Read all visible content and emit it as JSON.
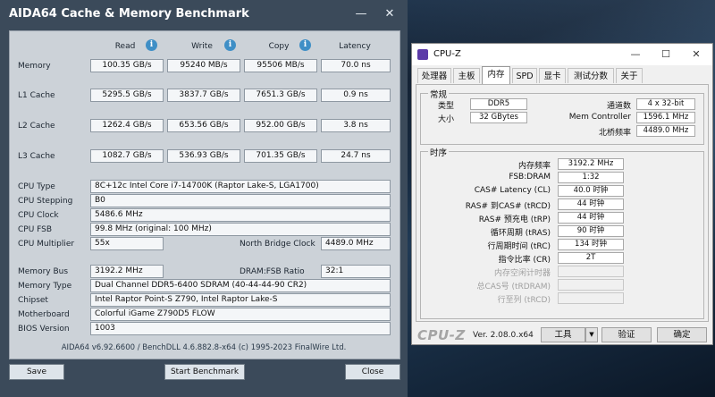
{
  "aida": {
    "title": "AIDA64 Cache & Memory Benchmark",
    "window_controls": {
      "minimize": "—",
      "close": "✕"
    },
    "columns": [
      "Read",
      "Write",
      "Copy",
      "Latency"
    ],
    "bench_rows": [
      {
        "label": "Memory",
        "read": "100.35 GB/s",
        "write": "95240 MB/s",
        "copy": "95506 MB/s",
        "latency": "70.0 ns"
      },
      {
        "label": "L1 Cache",
        "read": "5295.5 GB/s",
        "write": "3837.7 GB/s",
        "copy": "7651.3 GB/s",
        "latency": "0.9 ns"
      },
      {
        "label": "L2 Cache",
        "read": "1262.4 GB/s",
        "write": "653.56 GB/s",
        "copy": "952.00 GB/s",
        "latency": "3.8 ns"
      },
      {
        "label": "L3 Cache",
        "read": "1082.7 GB/s",
        "write": "536.93 GB/s",
        "copy": "701.35 GB/s",
        "latency": "24.7 ns"
      }
    ],
    "cpu": {
      "type_label": "CPU Type",
      "type": "8C+12c Intel Core i7-14700K  (Raptor Lake-S, LGA1700)",
      "stepping_label": "CPU Stepping",
      "stepping": "B0",
      "clock_label": "CPU Clock",
      "clock": "5486.6 MHz",
      "fsb_label": "CPU FSB",
      "fsb": "99.8 MHz  (original: 100 MHz)",
      "mult_label": "CPU Multiplier",
      "mult": "55x",
      "nb_label": "North Bridge Clock",
      "nb": "4489.0 MHz"
    },
    "mem": {
      "bus_label": "Memory Bus",
      "bus": "3192.2 MHz",
      "ratio_label": "DRAM:FSB Ratio",
      "ratio": "32:1",
      "type_label": "Memory Type",
      "type": "Dual Channel DDR5-6400 SDRAM  (40-44-44-90 CR2)",
      "chipset_label": "Chipset",
      "chipset": "Intel Raptor Point-S Z790, Intel Raptor Lake-S",
      "mb_label": "Motherboard",
      "mb": "Colorful iGame Z790D5 FLOW",
      "bios_label": "BIOS Version",
      "bios": "1003"
    },
    "footer": "AIDA64 v6.92.6600 / BenchDLL 4.6.882.8-x64  (c) 1995-2023 FinalWire Ltd.",
    "buttons": {
      "save": "Save",
      "start": "Start Benchmark",
      "close": "Close"
    }
  },
  "cpuz": {
    "title": "CPU-Z",
    "window_controls": {
      "minimize": "—",
      "maximize": "☐",
      "close": "✕"
    },
    "tabs": [
      "处理器",
      "主板",
      "内存",
      "SPD",
      "显卡",
      "测试分数",
      "关于"
    ],
    "active_tab": "内存",
    "general": {
      "group": "常规",
      "type_label": "类型",
      "type": "DDR5",
      "size_label": "大小",
      "size": "32 GBytes",
      "channels_label": "通道数",
      "channels": "4 x 32-bit",
      "memctrl_label": "Mem Controller",
      "memctrl": "1596.1 MHz",
      "nb_label": "北桥频率",
      "nb": "4489.0 MHz"
    },
    "timings": {
      "group": "时序",
      "rows": [
        {
          "label": "内存频率",
          "value": "3192.2 MHz",
          "enabled": true
        },
        {
          "label": "FSB:DRAM",
          "value": "1:32",
          "enabled": true
        },
        {
          "label": "CAS# Latency (CL)",
          "value": "40.0 时钟",
          "enabled": true
        },
        {
          "label": "RAS# 到CAS# (tRCD)",
          "value": "44 时钟",
          "enabled": true
        },
        {
          "label": "RAS# 预充电 (tRP)",
          "value": "44 时钟",
          "enabled": true
        },
        {
          "label": "循环周期 (tRAS)",
          "value": "90 时钟",
          "enabled": true
        },
        {
          "label": "行周期时间 (tRC)",
          "value": "134 时钟",
          "enabled": true
        },
        {
          "label": "指令比率 (CR)",
          "value": "2T",
          "enabled": true
        },
        {
          "label": "内存空闲计时器",
          "value": "",
          "enabled": false
        },
        {
          "label": "总CAS号 (tRDRAM)",
          "value": "",
          "enabled": false
        },
        {
          "label": "行至列 (tRCD)",
          "value": "",
          "enabled": false
        }
      ]
    },
    "brand": "CPU-Z",
    "version": "Ver. 2.08.0.x64",
    "buttons": {
      "tools": "工具",
      "dropdown": "▼",
      "validate": "验证",
      "ok": "确定"
    }
  }
}
